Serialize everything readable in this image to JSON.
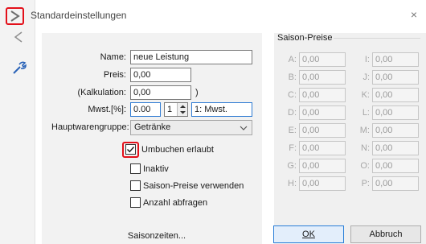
{
  "window": {
    "title": "Standardeinstellungen",
    "close_glyph": "×"
  },
  "sidebar": {
    "icons": [
      "chevron-right-icon",
      "chevron-left-icon",
      "wrench-icon"
    ]
  },
  "form": {
    "name_label": "Name:",
    "name_value": "neue Leistung",
    "price_label": "Preis:",
    "price_value": "0,00",
    "calc_label": "(Kalkulation:",
    "calc_value": "0,00",
    "calc_close": ")",
    "vat_label": "Mwst.[%]:",
    "vat_value": "0.00",
    "vat_num": "1",
    "vat_desc": "1: Mwst.",
    "group_label": "Hauptwarengruppe:",
    "group_value": "Getränke",
    "checkboxes": [
      {
        "label": "Umbuchen erlaubt",
        "checked": true
      },
      {
        "label": "Inaktiv",
        "checked": false
      },
      {
        "label": "Saison-Preise verwenden",
        "checked": false
      },
      {
        "label": "Anzahl abfragen",
        "checked": false
      }
    ]
  },
  "season": {
    "title": "Saison-Preise",
    "left": [
      {
        "letter": "A:",
        "value": "0,00"
      },
      {
        "letter": "B:",
        "value": "0,00"
      },
      {
        "letter": "C:",
        "value": "0,00"
      },
      {
        "letter": "D:",
        "value": "0,00"
      },
      {
        "letter": "E:",
        "value": "0,00"
      },
      {
        "letter": "F:",
        "value": "0,00"
      },
      {
        "letter": "G:",
        "value": "0,00"
      },
      {
        "letter": "H:",
        "value": "0,00"
      }
    ],
    "right": [
      {
        "letter": "I:",
        "value": "0,00"
      },
      {
        "letter": "J:",
        "value": "0,00"
      },
      {
        "letter": "K:",
        "value": "0,00"
      },
      {
        "letter": "L:",
        "value": "0,00"
      },
      {
        "letter": "M:",
        "value": "0,00"
      },
      {
        "letter": "N:",
        "value": "0,00"
      },
      {
        "letter": "O:",
        "value": "0,00"
      },
      {
        "letter": "P:",
        "value": "0,00"
      }
    ]
  },
  "buttons": {
    "season_times": "Saisonzeiten...",
    "ok": "OK",
    "cancel": "Abbruch"
  }
}
